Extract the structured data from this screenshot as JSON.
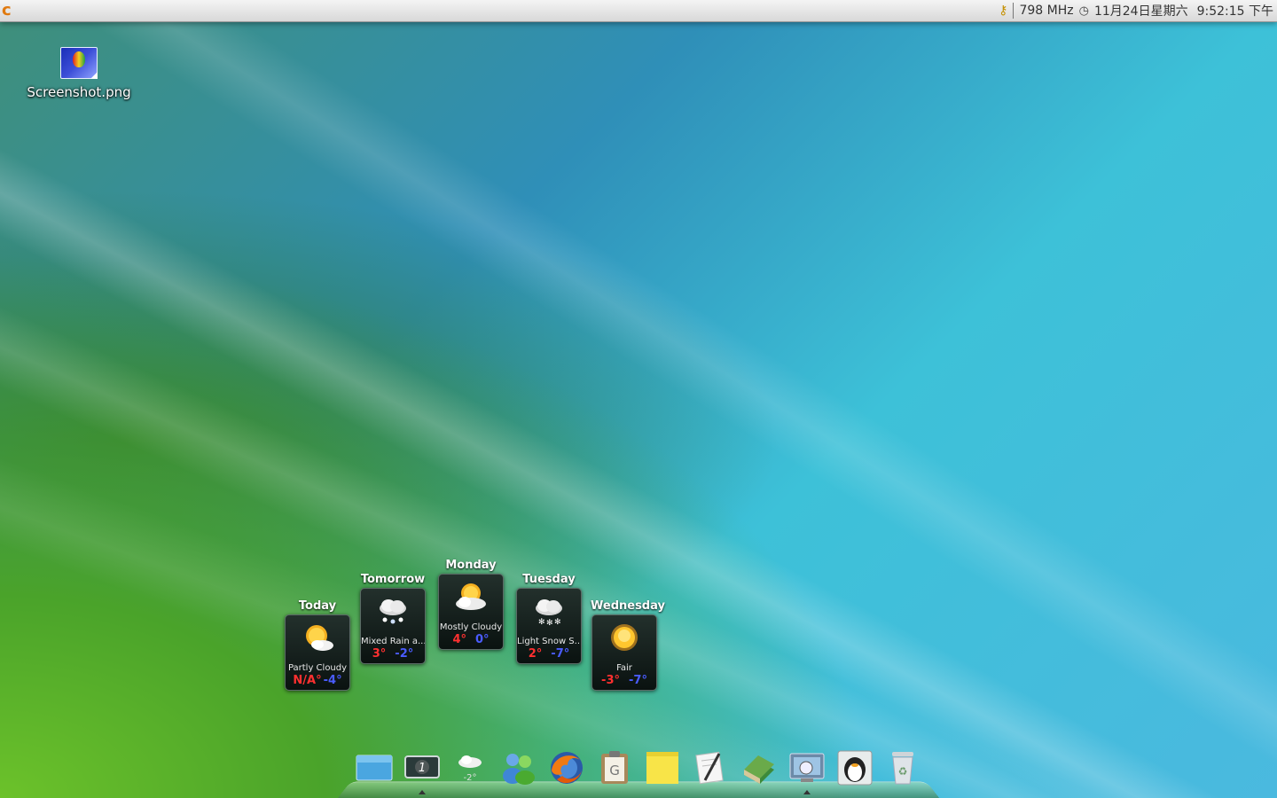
{
  "panel": {
    "cpu_freq": "798 MHz",
    "date": "11月24日星期六",
    "time": "9:52:15 下午"
  },
  "desktop_icons": [
    {
      "label": "Screenshot.png",
      "icon": "image-file-icon"
    }
  ],
  "weather": [
    {
      "day": "Today",
      "condition": "Partly Cloudy",
      "high": "N/A°",
      "low": "-4°",
      "icon": "partly-cloudy-icon"
    },
    {
      "day": "Tomorrow",
      "condition": "Mixed Rain a...",
      "high": "3°",
      "low": "-2°",
      "icon": "rain-snow-icon"
    },
    {
      "day": "Monday",
      "condition": "Mostly Cloudy",
      "high": "4°",
      "low": "0°",
      "icon": "mostly-cloudy-icon"
    },
    {
      "day": "Tuesday",
      "condition": "Light Snow S...",
      "high": "2°",
      "low": "-7°",
      "icon": "light-snow-icon"
    },
    {
      "day": "Wednesday",
      "condition": "Fair",
      "high": "-3°",
      "low": "-7°",
      "icon": "sun-icon"
    }
  ],
  "dock": {
    "weather_badge": "-2°",
    "workspace_number": "1",
    "items": [
      "desktop-icon",
      "workspace-switcher-icon",
      "weather-icon",
      "contacts-icon",
      "firefox-icon",
      "clipboard-icon",
      "sticky-note-icon",
      "text-editor-icon",
      "dictionary-icon",
      "screenshot-tool-icon",
      "qq-penguin-icon",
      "trash-icon"
    ]
  },
  "colors": {
    "temp_high": "#ff3030",
    "temp_low": "#4a5cff",
    "panel_bg": "#e6e6e6"
  }
}
